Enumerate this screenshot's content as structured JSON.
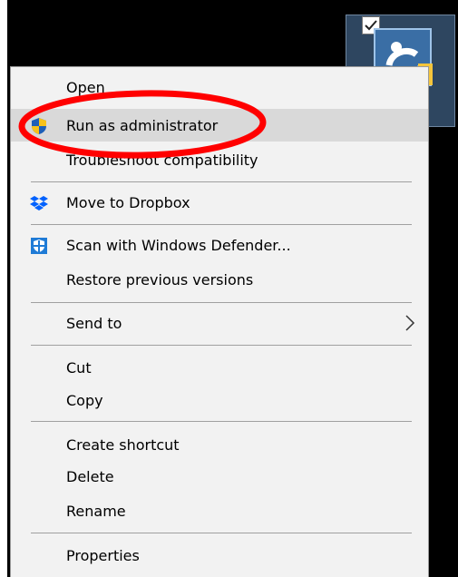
{
  "menu": {
    "items": [
      {
        "label": "Open",
        "icon": "none"
      },
      {
        "label": "Run as administrator",
        "icon": "uac-shield-icon"
      },
      {
        "label": "Troubleshoot compatibility",
        "icon": "none"
      },
      {
        "label": "Move to Dropbox",
        "icon": "dropbox-icon"
      },
      {
        "label": "Scan with Windows Defender...",
        "icon": "windows-defender-icon"
      },
      {
        "label": "Restore previous versions",
        "icon": "none"
      },
      {
        "label": "Send to",
        "icon": "none",
        "submenu": true
      },
      {
        "label": "Cut",
        "icon": "none"
      },
      {
        "label": "Copy",
        "icon": "none"
      },
      {
        "label": "Create shortcut",
        "icon": "none"
      },
      {
        "label": "Delete",
        "icon": "none"
      },
      {
        "label": "Rename",
        "icon": "none"
      },
      {
        "label": "Properties",
        "icon": "none"
      }
    ],
    "highlighted_item": "Run as administrator"
  },
  "desktop_icon": {
    "icon": "app-shortcut-icon",
    "checked": true
  },
  "colors": {
    "menu_bg": "#f2f2f2",
    "hover_bg": "#d9d9d9",
    "separator": "#a0a0a0",
    "annotation": "#ff0000",
    "dropbox_blue": "#0061fe",
    "defender_blue": "#1f7bd6",
    "shield_yellow": "#f7c21a",
    "shield_blue": "#1d5fb8"
  }
}
